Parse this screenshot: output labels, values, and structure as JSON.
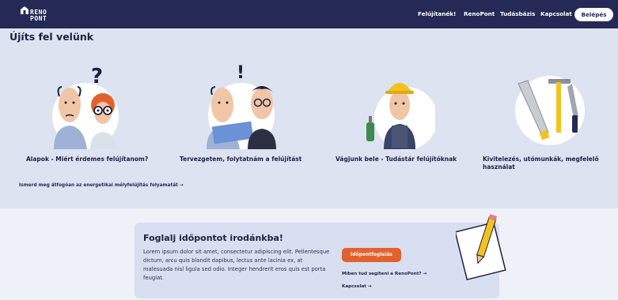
{
  "header": {
    "logo_line1": "RENO",
    "logo_line2": "PONT",
    "nav": [
      "Felújítanék!",
      "RenoPont",
      "Tudásbázis",
      "Kapcsolat"
    ],
    "login_label": "Belépés"
  },
  "section": {
    "title": "Újíts fel velünk",
    "cards": [
      {
        "title": "Alapok - Miért érdemes felújítanom?",
        "icon": "two-people-question-illustration"
      },
      {
        "title": "Tervezgetem, folytatnám a felújítást",
        "icon": "planning-illustration"
      },
      {
        "title": "Vágjunk bele - Tudástár felújítóknak",
        "icon": "builder-illustration"
      },
      {
        "title": "Kivitelezés, utómunkák, megfelelő használat",
        "icon": "tools-illustration"
      }
    ],
    "learn_more": "Ismerd meg átfogóan az energetikai mélyfelújítás folyamatát →"
  },
  "booking": {
    "title": "Foglalj időpontot irodánkba!",
    "text": "Lorem ipsum dolor sit amet, consectetur adipiscing elit. Pellentesque dictum, arcu quis blandit dapibus, lectus ante lacinia ex, at malesuada nisl ligula sed odio. Integer hendrerit eros quis est porta feugiat.",
    "button": "Időpontfoglalás",
    "link_help": "Miben tud segíteni a RenoPont? →",
    "link_contact": "Kapcsolat →",
    "icon": "note-pencil-illustration"
  },
  "colors": {
    "navy": "#242a55",
    "accent": "#e2622d",
    "bg": "#dde3f1"
  }
}
